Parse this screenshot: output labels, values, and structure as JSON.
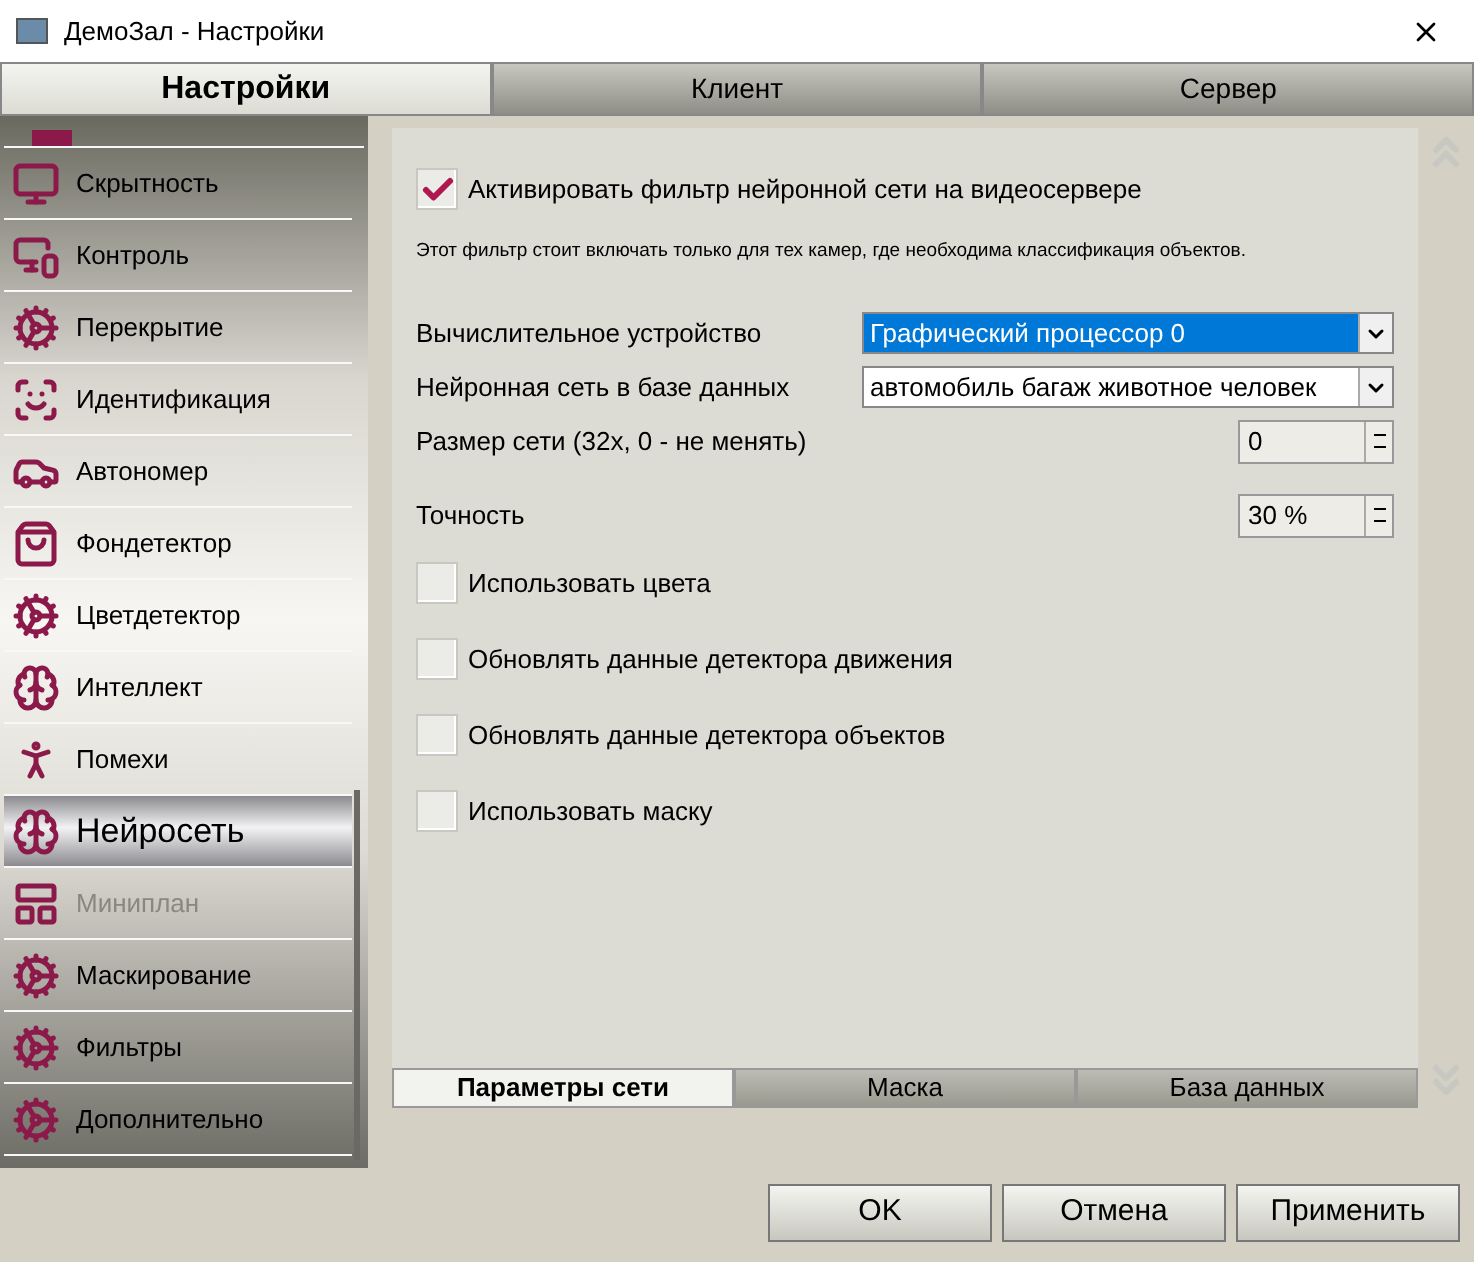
{
  "window": {
    "title": "ДемоЗал - Настройки"
  },
  "tabs": [
    {
      "label": "Настройки",
      "selected": true
    },
    {
      "label": "Клиент",
      "selected": false
    },
    {
      "label": "Сервер",
      "selected": false
    }
  ],
  "sidebar": {
    "items": [
      {
        "label": "Скрытность",
        "selected": false,
        "disabled": false
      },
      {
        "label": "Контроль",
        "selected": false,
        "disabled": false
      },
      {
        "label": "Перекрытие",
        "selected": false,
        "disabled": false
      },
      {
        "label": "Идентификация",
        "selected": false,
        "disabled": false
      },
      {
        "label": "Автономер",
        "selected": false,
        "disabled": false
      },
      {
        "label": "Фондетектор",
        "selected": false,
        "disabled": false
      },
      {
        "label": "Цветдетектор",
        "selected": false,
        "disabled": false
      },
      {
        "label": "Интеллект",
        "selected": false,
        "disabled": false
      },
      {
        "label": "Помехи",
        "selected": false,
        "disabled": false
      },
      {
        "label": "Нейросеть",
        "selected": true,
        "disabled": false
      },
      {
        "label": "Миниплан",
        "selected": false,
        "disabled": true
      },
      {
        "label": "Маскирование",
        "selected": false,
        "disabled": false
      },
      {
        "label": "Фильтры",
        "selected": false,
        "disabled": false
      },
      {
        "label": "Дополнительно",
        "selected": false,
        "disabled": false
      }
    ]
  },
  "main_checkbox": {
    "label": "Активировать фильтр нейронной сети на видеосервере",
    "checked": true
  },
  "hint": "Этот фильтр стоит включать только для тех камер, где необходима классификация объектов.",
  "fields": [
    {
      "kind": "dropdown",
      "label": "Вычислительное устройство",
      "value": "Графический процессор 0"
    },
    {
      "kind": "dropdown",
      "label": "Нейронная сеть в базе данных",
      "value": "автомобиль багаж животное человек"
    },
    {
      "kind": "spin",
      "label": "Размер сети (32x, 0 - не менять)",
      "value": "0"
    },
    {
      "kind": "spin",
      "label": "Точность",
      "value": "30 %"
    }
  ],
  "checkboxes": [
    {
      "label": "Использовать цвета",
      "checked": false
    },
    {
      "label": "Обновлять данные детектора движения",
      "checked": false
    },
    {
      "label": "Обновлять данные детектора объектов",
      "checked": false
    },
    {
      "label": "Использовать маску",
      "checked": false
    }
  ],
  "subtabs": [
    {
      "label": "Параметры сети",
      "selected": true
    },
    {
      "label": "Маска",
      "selected": false
    },
    {
      "label": "База данных",
      "selected": false
    }
  ],
  "buttons": [
    "OK",
    "Отмена",
    "Применить"
  ]
}
